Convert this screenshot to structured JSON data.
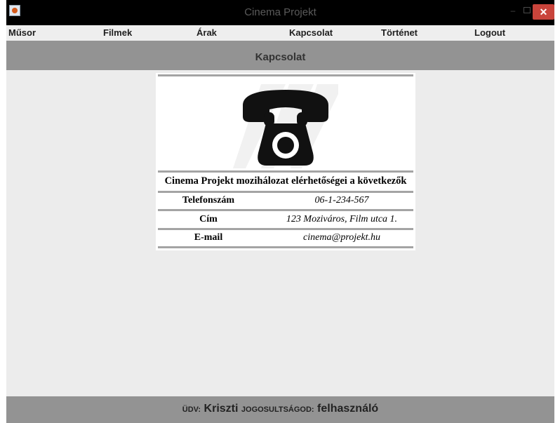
{
  "window": {
    "title": "Cinema Projekt",
    "minimize_label": "–",
    "close_label": "✕"
  },
  "menu": [
    {
      "label": "Műsor"
    },
    {
      "label": "Filmek"
    },
    {
      "label": "Árak"
    },
    {
      "label": "Kapcsolat"
    },
    {
      "label": "Történet"
    },
    {
      "label": "Logout"
    }
  ],
  "page": {
    "title": "Kapcsolat",
    "icon": "telephone-icon"
  },
  "contact": {
    "heading": "Cinema Projekt mozihálozat elérhetőségei a következők",
    "rows": [
      {
        "label": "Telefonszám",
        "value": "06-1-234-567"
      },
      {
        "label": "Cím",
        "value": "123 Moziváros, Film utca 1."
      },
      {
        "label": "E-mail",
        "value": "cinema@projekt.hu"
      }
    ]
  },
  "footer": {
    "greeting_label": "ÜDV:",
    "username": "Kriszti",
    "role_label": "JOGOSULTSÁGOD:",
    "role": "felhasználó"
  }
}
